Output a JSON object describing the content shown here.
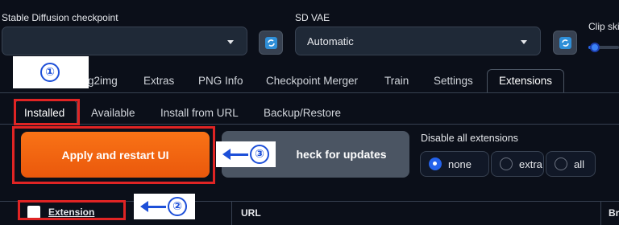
{
  "header": {
    "checkpoint": {
      "label": "Stable Diffusion checkpoint",
      "value": ""
    },
    "vae": {
      "label": "SD VAE",
      "value": "Automatic"
    },
    "clip_skip": {
      "label": "Clip ski"
    }
  },
  "tabs": [
    {
      "label": "g2img"
    },
    {
      "label": "Extras"
    },
    {
      "label": "PNG Info"
    },
    {
      "label": "Checkpoint Merger"
    },
    {
      "label": "Train"
    },
    {
      "label": "Settings"
    },
    {
      "label": "Extensions"
    }
  ],
  "subtabs": [
    {
      "label": "Installed"
    },
    {
      "label": "Available"
    },
    {
      "label": "Install from URL"
    },
    {
      "label": "Backup/Restore"
    }
  ],
  "actions": {
    "apply_label": "Apply and restart UI",
    "check_label": "heck for updates"
  },
  "disable_all": {
    "label": "Disable all extensions",
    "options": [
      "none",
      "extra",
      "all"
    ],
    "selected": "none"
  },
  "table": {
    "columns": [
      "Extension",
      "URL",
      "Br"
    ]
  },
  "annotations": {
    "step1": "①",
    "step2": "②",
    "step3": "③"
  },
  "colors": {
    "background": "#0b0f19",
    "primary_button": "#f97316",
    "annotation_red": "#e02424",
    "annotation_blue": "#1d4fd8"
  }
}
